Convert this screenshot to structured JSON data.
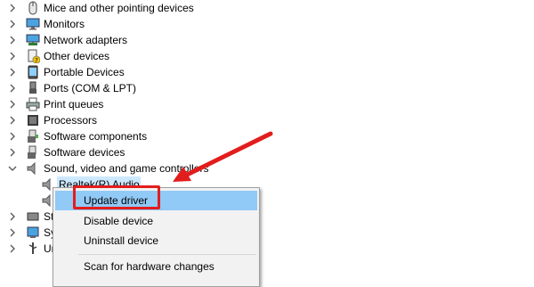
{
  "tree": {
    "items": [
      {
        "label": "Mice and other pointing devices",
        "icon": "mouse-icon",
        "expanded": false
      },
      {
        "label": "Monitors",
        "icon": "monitor-icon",
        "expanded": false
      },
      {
        "label": "Network adapters",
        "icon": "network-adapter-icon",
        "expanded": false
      },
      {
        "label": "Other devices",
        "icon": "unknown-device-icon",
        "expanded": false
      },
      {
        "label": "Portable Devices",
        "icon": "portable-device-icon",
        "expanded": false
      },
      {
        "label": "Ports (COM & LPT)",
        "icon": "port-icon",
        "expanded": false
      },
      {
        "label": "Print queues",
        "icon": "printer-icon",
        "expanded": false
      },
      {
        "label": "Processors",
        "icon": "processor-icon",
        "expanded": false
      },
      {
        "label": "Software components",
        "icon": "software-component-icon",
        "expanded": false
      },
      {
        "label": "Software devices",
        "icon": "software-device-icon",
        "expanded": false
      },
      {
        "label": "Sound, video and game controllers",
        "icon": "speaker-icon",
        "expanded": true
      }
    ],
    "children": [
      {
        "label": "Realtek(R) Audio",
        "icon": "speaker-icon",
        "selected": true
      },
      {
        "label": "",
        "icon": "speaker-icon",
        "selected": false
      }
    ],
    "partial_items": [
      {
        "label": "St",
        "icon": "storage-icon"
      },
      {
        "label": "Sy",
        "icon": "system-device-icon"
      },
      {
        "label": "Ur",
        "icon": "usb-icon"
      }
    ]
  },
  "context_menu": {
    "items": [
      {
        "label": "Update driver",
        "highlighted": true
      },
      {
        "label": "Disable device",
        "highlighted": false
      },
      {
        "label": "Uninstall device",
        "highlighted": false
      },
      {
        "label": "Scan for hardware changes",
        "highlighted": false
      }
    ]
  },
  "annotation": {
    "color": "#e21d1d"
  }
}
